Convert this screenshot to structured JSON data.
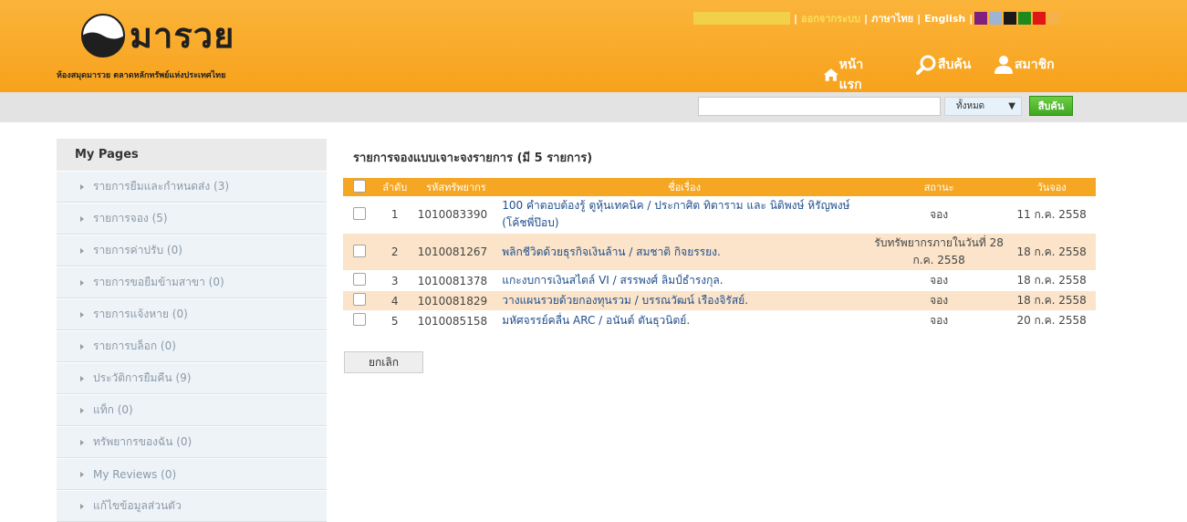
{
  "header": {
    "logo_text": "มารวย",
    "tagline": "ห้องสมุดมารวย ตลาดหลักทรัพย์แห่งประเทศไทย",
    "top_links": {
      "logout": "ออกจากระบบ",
      "thai": "ภาษาไทย",
      "english": "English",
      "separator": "|"
    },
    "theme_swatches": [
      "#7f1f7f",
      "#9db4d4",
      "#1a1a1a",
      "#1e8a1e",
      "#e01515",
      "#f5b24a"
    ],
    "nav": {
      "home": "หน้าแรก",
      "search": "สืบค้น",
      "member": "สมาชิก"
    }
  },
  "search": {
    "value": "",
    "scope": "ทั้งหมด",
    "button": "สืบค้น"
  },
  "sidebar": {
    "title": "My Pages",
    "items": [
      {
        "label": "รายการยืมและกำหนดส่ง (3)"
      },
      {
        "label": "รายการจอง (5)"
      },
      {
        "label": "รายการค่าปรับ (0)"
      },
      {
        "label": "รายการขอยืมข้ามสาขา (0)"
      },
      {
        "label": "รายการแจ้งหาย (0)"
      },
      {
        "label": "รายการบล็อก (0)"
      },
      {
        "label": "ประวัติการยืมคืน (9)"
      },
      {
        "label": "แท็ก (0)"
      },
      {
        "label": "ทรัพยากรของฉัน (0)"
      },
      {
        "label": "My Reviews (0)"
      },
      {
        "label": "แก้ไขข้อมูลส่วนตัว"
      }
    ]
  },
  "main": {
    "title": "รายการจองแบบเจาะจงรายการ (มี 5 รายการ)",
    "columns": {
      "no": "ลำดับ",
      "code": "รหัสทรัพยากร",
      "title": "ชื่อเรื่อง",
      "status": "สถานะ",
      "reserve": "วันจอง"
    },
    "rows": [
      {
        "no": "1",
        "code": "1010083390",
        "title": "100 คำตอบต้องรู้ ตูหุ้นเทคนิค / ประกาศิต ทิตาราม และ นิติพงษ์ หิรัญพงษ์ (โค้ชพี่ป๊อบ)",
        "status": "จอง",
        "date": "11 ก.ค. 2558"
      },
      {
        "no": "2",
        "code": "1010081267",
        "title": "พลิกชีวิตด้วยธุรกิจเงินล้าน / สมชาติ กิจยรรยง.",
        "status": "รับทรัพยากรภายในวันที่ 28 ก.ค. 2558",
        "date": "18 ก.ค. 2558"
      },
      {
        "no": "3",
        "code": "1010081378",
        "title": "แกะงบการเงินสไตล์ VI / สรรพงศ์ ลิมป์ธำรงกุล.",
        "status": "จอง",
        "date": "18 ก.ค. 2558"
      },
      {
        "no": "4",
        "code": "1010081829",
        "title": "วางแผนรวยด้วยกองทุนรวม / บรรณวัฒน์ เรืองจิรัสย์.",
        "status": "จอง",
        "date": "18 ก.ค. 2558"
      },
      {
        "no": "5",
        "code": "1010085158",
        "title": "มหัศจรรย์คลื่น ARC / อนันต์ ตันธุวนิตย์.",
        "status": "จอง",
        "date": "20 ก.ค. 2558"
      }
    ],
    "cancel_button": "ยกเลิก"
  }
}
